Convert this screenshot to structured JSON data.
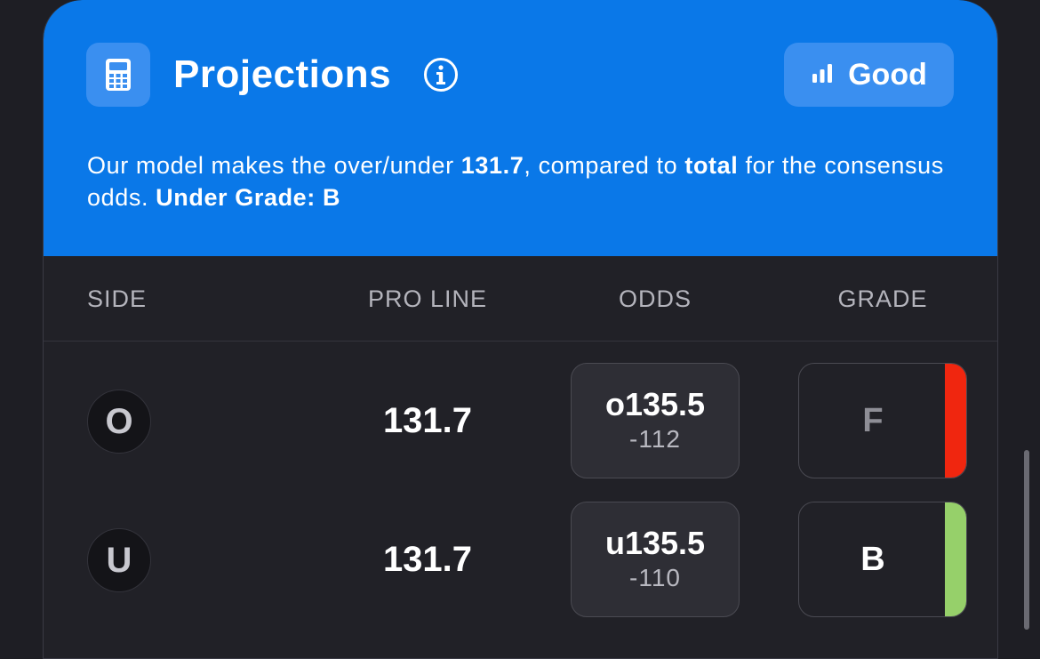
{
  "header": {
    "title": "Projections",
    "quality_label": "Good",
    "desc_prefix": "Our model makes the over/under ",
    "desc_value": "131.7",
    "desc_middle": ", compared to ",
    "desc_total": "total",
    "desc_suffix": " for the consensus odds. ",
    "desc_grade": "Under Grade: B"
  },
  "table": {
    "columns": [
      "SIDE",
      "PRO LINE",
      "ODDS",
      "GRADE"
    ],
    "rows": [
      {
        "side": "O",
        "pro_line": "131.7",
        "odds_line": "o135.5",
        "odds_price": "-112",
        "grade": "F",
        "grade_color": "#f0260f",
        "grade_text_color": "#8e8e96"
      },
      {
        "side": "U",
        "pro_line": "131.7",
        "odds_line": "u135.5",
        "odds_price": "-110",
        "grade": "B",
        "grade_color": "#96d06a",
        "grade_text_color": "#ffffff"
      }
    ]
  },
  "colors": {
    "header_bg": "#0a78e8",
    "page_bg": "#1e1e24"
  },
  "icons": {
    "calculator": "calculator-icon",
    "info": "info-icon",
    "signal": "signal-bars-icon"
  }
}
